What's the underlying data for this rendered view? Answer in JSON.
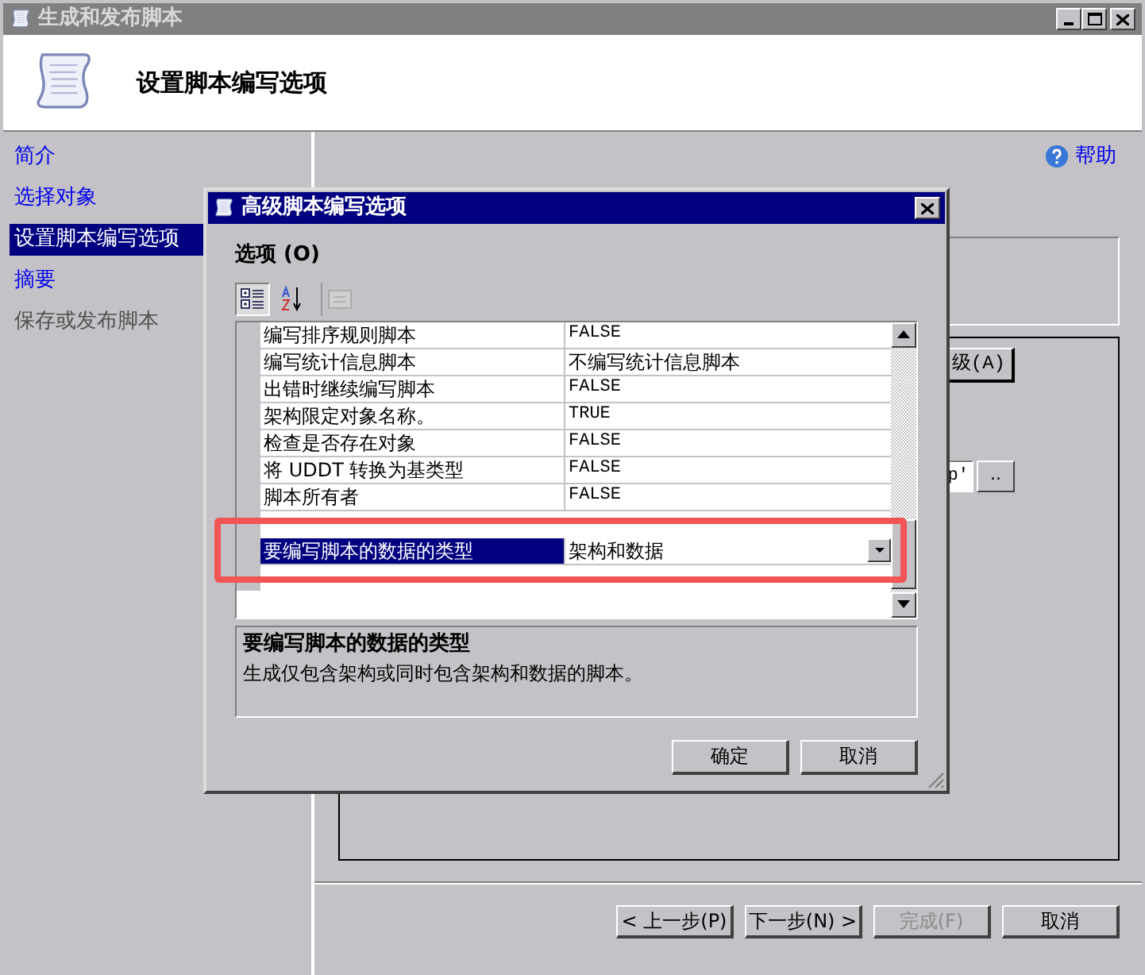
{
  "window": {
    "title": "生成和发布脚本"
  },
  "header": {
    "title": "设置脚本编写选项"
  },
  "nav": {
    "items": [
      {
        "label": "简介",
        "selected": false,
        "disabled": false
      },
      {
        "label": "选择对象",
        "selected": false,
        "disabled": false
      },
      {
        "label": "设置脚本编写选项",
        "selected": true,
        "disabled": false
      },
      {
        "label": "摘要",
        "selected": false,
        "disabled": false
      },
      {
        "label": "保存或发布脚本",
        "selected": false,
        "disabled": true
      }
    ]
  },
  "help_link": "帮助",
  "background": {
    "advanced_button": "级(A)",
    "file_field": "p'",
    "browse_button": ".."
  },
  "dialog": {
    "title": "高级脚本编写选项",
    "section_label": "选项 (O)",
    "toolbar": [
      {
        "kind": "categorized",
        "selected": true,
        "disabled": false
      },
      {
        "kind": "alphabetical",
        "selected": false,
        "disabled": false
      },
      {
        "kind": "pages",
        "selected": false,
        "disabled": true
      }
    ],
    "properties": [
      {
        "name": "编写排序规则脚本",
        "value": "FALSE",
        "selected": false
      },
      {
        "name": "编写统计信息脚本",
        "value": "不编写统计信息脚本",
        "selected": false
      },
      {
        "name": "出错时继续编写脚本",
        "value": "FALSE",
        "selected": false
      },
      {
        "name": "架构限定对象名称。",
        "value": "TRUE",
        "selected": false
      },
      {
        "name": "检查是否存在对象",
        "value": "FALSE",
        "selected": false
      },
      {
        "name": "将 UDDT 转换为基类型",
        "value": "FALSE",
        "selected": false
      },
      {
        "name": "脚本所有者",
        "value": "FALSE",
        "selected": false
      },
      {
        "name": "要编写脚本的数据的类型",
        "value": "架构和数据",
        "selected": true
      }
    ],
    "description": {
      "title": "要编写脚本的数据的类型",
      "text": "生成仅包含架构或同时包含架构和数据的脚本。"
    },
    "buttons": [
      "确定",
      "取消"
    ]
  },
  "wizard_buttons": [
    {
      "label": "< 上一步(P)",
      "disabled": false
    },
    {
      "label": "下一步(N) >",
      "disabled": false
    },
    {
      "label": "完成(F)",
      "disabled": true
    },
    {
      "label": "取消",
      "disabled": false
    }
  ]
}
